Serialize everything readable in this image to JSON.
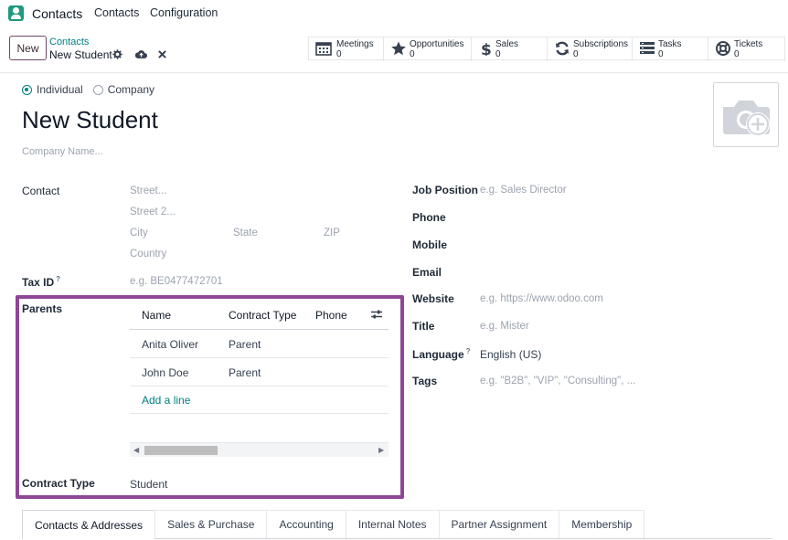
{
  "nav": {
    "app_name": "Contacts",
    "menu": [
      "Contacts",
      "Configuration"
    ]
  },
  "control": {
    "new_label": "New",
    "breadcrumb_parent": "Contacts",
    "breadcrumb_current": "New Student",
    "stats": [
      {
        "label": "Meetings",
        "count": "0",
        "icon": "calendar-icon"
      },
      {
        "label": "Opportunities",
        "count": "0",
        "icon": "star-icon"
      },
      {
        "label": "Sales",
        "count": "0",
        "icon": "dollar-icon"
      },
      {
        "label": "Subscriptions",
        "count": "0",
        "icon": "refresh-icon"
      },
      {
        "label": "Tasks",
        "count": "0",
        "icon": "tasks-icon"
      },
      {
        "label": "Tickets",
        "count": "0",
        "icon": "lifebuoy-icon"
      }
    ]
  },
  "form": {
    "type_individual": "Individual",
    "type_company": "Company",
    "selected_type": "Individual",
    "name": "New Student",
    "company_placeholder": "Company Name...",
    "contact_label": "Contact",
    "street_ph": "Street...",
    "street2_ph": "Street 2...",
    "city_ph": "City",
    "state_ph": "State",
    "zip_ph": "ZIP",
    "country_ph": "Country",
    "taxid_label": "Tax ID",
    "taxid_help": "?",
    "taxid_ph": "e.g. BE0477472701",
    "parents_label": "Parents",
    "contract_type_label": "Contract Type",
    "contract_type_value": "Student",
    "job_position_label": "Job Position",
    "job_position_ph": "e.g. Sales Director",
    "phone_label": "Phone",
    "mobile_label": "Mobile",
    "email_label": "Email",
    "website_label": "Website",
    "website_ph": "e.g. https://www.odoo.com",
    "title_label": "Title",
    "title_ph": "e.g. Mister",
    "language_label": "Language",
    "language_help": "?",
    "language_value": "English (US)",
    "tags_label": "Tags",
    "tags_ph": "e.g. \"B2B\", \"VIP\", \"Consulting\", ..."
  },
  "parents_table": {
    "columns": [
      "Name",
      "Contract Type",
      "Phone"
    ],
    "rows": [
      {
        "name": "Anita Oliver",
        "contract_type": "Parent",
        "phone": ""
      },
      {
        "name": "John Doe",
        "contract_type": "Parent",
        "phone": ""
      }
    ],
    "add_line": "Add a line"
  },
  "tabs": [
    "Contacts & Addresses",
    "Sales & Purchase",
    "Accounting",
    "Internal Notes",
    "Partner Assignment",
    "Membership"
  ],
  "active_tab": "Contacts & Addresses",
  "colors": {
    "accent": "#017e84",
    "brand": "#714b67",
    "highlight": "#8e4697"
  }
}
